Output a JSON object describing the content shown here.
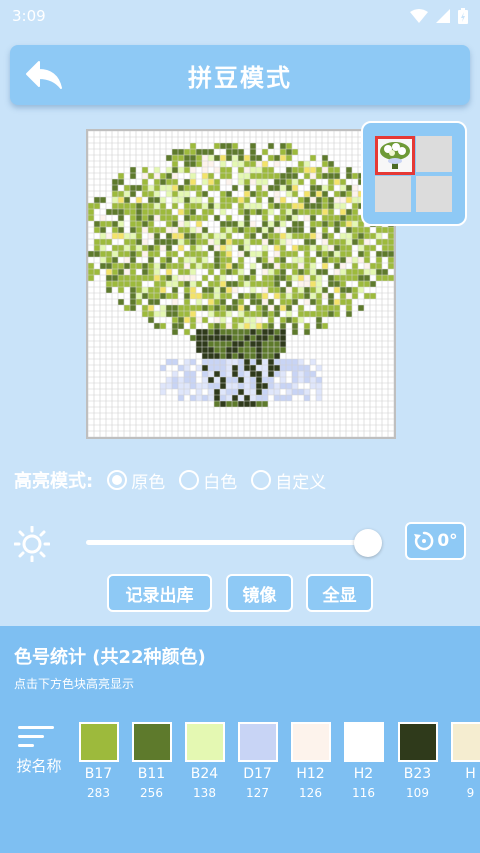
{
  "status_bar": {
    "time": "3:09"
  },
  "header": {
    "title": "拼豆模式"
  },
  "highlight_mode": {
    "label": "高亮模式:",
    "options": [
      {
        "label": "原色",
        "selected": true
      },
      {
        "label": "白色",
        "selected": false
      },
      {
        "label": "自定义",
        "selected": false
      }
    ]
  },
  "brightness": {
    "level": 0.98,
    "rotation_label": "0°"
  },
  "buttons": {
    "record": "记录出库",
    "mirror": "镜像",
    "show_all": "全显"
  },
  "stats": {
    "title": "色号统计 (共22种颜色)",
    "hint": "点击下方色块高亮显示",
    "sort_label": "按名称",
    "colors": [
      {
        "code": "B17",
        "count": "283",
        "color": "#9dba3c"
      },
      {
        "code": "B11",
        "count": "256",
        "color": "#5e7a2c"
      },
      {
        "code": "B24",
        "count": "138",
        "color": "#e4f8b2"
      },
      {
        "code": "D17",
        "count": "127",
        "color": "#c8d4f5"
      },
      {
        "code": "H12",
        "count": "126",
        "color": "#fdf3ec"
      },
      {
        "code": "H2",
        "count": "116",
        "color": "#ffffff"
      },
      {
        "code": "B23",
        "count": "109",
        "color": "#2f3a1b"
      },
      {
        "code": "H",
        "count": "9",
        "color": "#f5edd0"
      }
    ]
  },
  "palette": {
    "accent": "#8ec9f5",
    "background": "#c9e3f9",
    "panel": "#7ebff2"
  }
}
